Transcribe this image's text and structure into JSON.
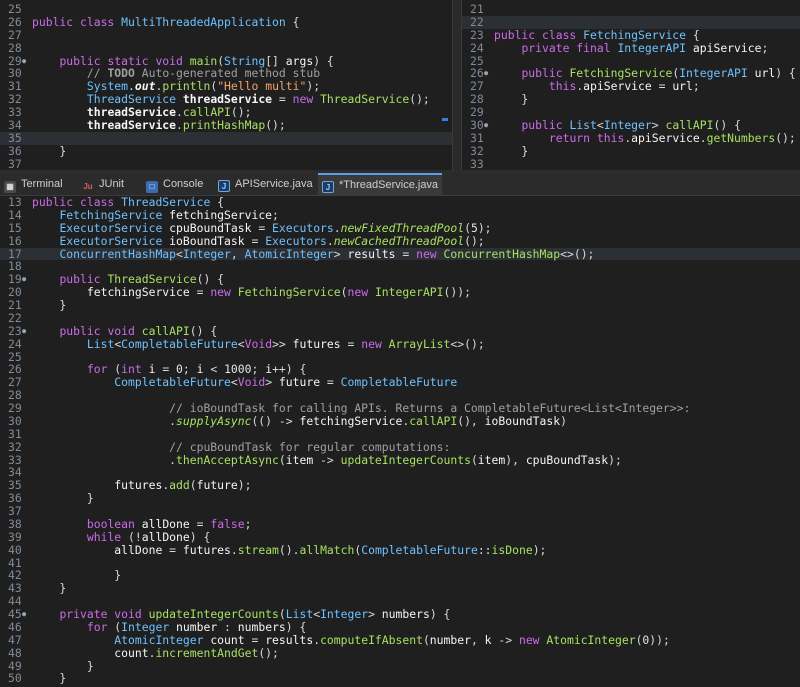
{
  "left_editor": {
    "lines": [
      {
        "n": "25",
        "html": ""
      },
      {
        "n": "26",
        "html": "<span class='k'>public class</span> <span class='t'>MultiThreadedApplication</span> {"
      },
      {
        "n": "27",
        "html": ""
      },
      {
        "n": "28",
        "html": ""
      },
      {
        "n": "29",
        "marker": true,
        "html": "    <span class='k'>public static void</span> <span class='f'>main</span>(<span class='t'>String</span>[] <span class='v'>args</span>) {"
      },
      {
        "n": "30",
        "html": "        <span class='c'>// <b>TODO</b> Auto-generated method stub</span>"
      },
      {
        "n": "31",
        "html": "        <span class='t'>System</span>.<span class='v b i'>out</span>.<span class='f'>println</span>(<span class='s'>\"Hello multi\"</span>);"
      },
      {
        "n": "32",
        "html": "        <span class='t'>ThreadService</span> <span class='v b'>threadService</span> = <span class='k'>new</span> <span class='f'>ThreadService</span>();"
      },
      {
        "n": "33",
        "html": "        <span class='v b'>threadService</span>.<span class='f'>callAPI</span>();"
      },
      {
        "n": "34",
        "html": "        <span class='v b'>threadService</span>.<span class='f'>printHashMap</span>();"
      },
      {
        "n": "35",
        "current": true,
        "html": ""
      },
      {
        "n": "36",
        "html": "    }"
      },
      {
        "n": "37",
        "html": ""
      }
    ]
  },
  "right_editor": {
    "lines": [
      {
        "n": "21",
        "html": ""
      },
      {
        "n": "22",
        "current": true,
        "html": ""
      },
      {
        "n": "23",
        "html": "<span class='k'>public class</span> <span class='t'>FetchingService</span> {"
      },
      {
        "n": "24",
        "html": "    <span class='k'>private final</span> <span class='t'>IntegerAPI</span> <span class='v'>apiService</span>;"
      },
      {
        "n": "25",
        "html": ""
      },
      {
        "n": "26",
        "marker": true,
        "html": "    <span class='k'>public</span> <span class='f'>FetchingService</span>(<span class='t'>IntegerAPI</span> <span class='v'>url</span>) {"
      },
      {
        "n": "27",
        "html": "        <span class='k'>this</span>.<span class='v'>apiService</span> = <span class='v'>url</span>;"
      },
      {
        "n": "28",
        "html": "    }"
      },
      {
        "n": "29",
        "html": ""
      },
      {
        "n": "30",
        "marker": true,
        "html": "    <span class='k'>public</span> <span class='t'>List</span>&lt;<span class='t'>Integer</span>&gt; <span class='f'>callAPI</span>() {"
      },
      {
        "n": "31",
        "html": "        <span class='k'>return this</span>.<span class='v'>apiService</span>.<span class='f'>getNumbers</span>();"
      },
      {
        "n": "32",
        "html": "    }"
      },
      {
        "n": "33",
        "html": ""
      }
    ]
  },
  "tabs": [
    {
      "label": "Terminal",
      "icon": "terminal-icon",
      "active": false
    },
    {
      "label": "JUnit",
      "icon": "junit-icon",
      "active": false
    },
    {
      "label": "Console",
      "icon": "console-icon",
      "active": false
    },
    {
      "label": "APIService.java",
      "icon": "java-file-icon",
      "active": false
    },
    {
      "label": "*ThreadService.java",
      "icon": "java-file-icon",
      "active": true
    }
  ],
  "main_editor": {
    "lines": [
      {
        "n": "13",
        "html": "<span class='k'>public class</span> <span class='t'>ThreadService</span> {"
      },
      {
        "n": "14",
        "html": "    <span class='t'>FetchingService</span> <span class='v'>fetchingService</span>;"
      },
      {
        "n": "15",
        "html": "    <span class='t'>ExecutorService</span> <span class='v'>cpuBoundTask</span> = <span class='t'>Executors</span>.<span class='f i'>newFixedThreadPool</span>(<span class='n'>5</span>);"
      },
      {
        "n": "16",
        "html": "    <span class='t'>ExecutorService</span> <span class='v'>ioBoundTask</span> = <span class='t'>Executors</span>.<span class='f i'>newCachedThreadPool</span>();"
      },
      {
        "n": "17",
        "current": true,
        "html": "    <span class='t'>ConcurrentHashMap</span>&lt;<span class='t'>Integer</span>, <span class='t'>AtomicInteger</span>&gt; <span class='v'>results</span> = <span class='k'>new</span> <span class='f'>ConcurrentHashMap</span>&lt;&gt;();"
      },
      {
        "n": "18",
        "html": ""
      },
      {
        "n": "19",
        "marker": true,
        "html": "    <span class='k'>public</span> <span class='f'>ThreadService</span>() {"
      },
      {
        "n": "20",
        "html": "        <span class='v'>fetchingService</span> = <span class='k'>new</span> <span class='f'>FetchingService</span>(<span class='k'>new</span> <span class='f'>IntegerAPI</span>());"
      },
      {
        "n": "21",
        "html": "    }"
      },
      {
        "n": "22",
        "html": ""
      },
      {
        "n": "23",
        "marker": true,
        "html": "    <span class='k'>public void</span> <span class='f'>callAPI</span>() {"
      },
      {
        "n": "24",
        "html": "        <span class='t'>List</span>&lt;<span class='t'>CompletableFuture</span>&lt;<span class='k'>Void</span>&gt;&gt; <span class='v'>futures</span> = <span class='k'>new</span> <span class='f'>ArrayList</span>&lt;&gt;();"
      },
      {
        "n": "25",
        "html": ""
      },
      {
        "n": "26",
        "html": "        <span class='k'>for</span> (<span class='k'>int</span> <span class='v'>i</span> = <span class='n'>0</span>; <span class='v'>i</span> &lt; <span class='n'>1000</span>; <span class='v'>i</span>++) {"
      },
      {
        "n": "27",
        "html": "            <span class='t'>CompletableFuture</span>&lt;<span class='k'>Void</span>&gt; <span class='v'>future</span> = <span class='t'>CompletableFuture</span>"
      },
      {
        "n": "28",
        "html": ""
      },
      {
        "n": "29",
        "html": "                    <span class='c'>// ioBoundTask for calling APIs. Returns a CompletableFuture&lt;List&lt;Integer&gt;&gt;:</span>"
      },
      {
        "n": "30",
        "html": "                    .<span class='f i'>supplyAsync</span>(() -&gt; <span class='v'>fetchingService</span>.<span class='f'>callAPI</span>(), <span class='v'>ioBoundTask</span>)"
      },
      {
        "n": "31",
        "html": ""
      },
      {
        "n": "32",
        "html": "                    <span class='c'>// cpuBoundTask for regular computations:</span>"
      },
      {
        "n": "33",
        "html": "                    .<span class='f'>thenAcceptAsync</span>(<span class='v'>item</span> -&gt; <span class='f'>updateIntegerCounts</span>(<span class='v'>item</span>), <span class='v'>cpuBoundTask</span>);"
      },
      {
        "n": "34",
        "html": ""
      },
      {
        "n": "35",
        "html": "            <span class='v'>futures</span>.<span class='f'>add</span>(<span class='v'>future</span>);"
      },
      {
        "n": "36",
        "html": "        }"
      },
      {
        "n": "37",
        "html": ""
      },
      {
        "n": "38",
        "html": "        <span class='k'>boolean</span> <span class='v'>allDone</span> = <span class='k'>false</span>;"
      },
      {
        "n": "39",
        "html": "        <span class='k'>while</span> (!<span class='v'>allDone</span>) {"
      },
      {
        "n": "40",
        "html": "            <span class='v'>allDone</span> = <span class='v'>futures</span>.<span class='f'>stream</span>().<span class='f'>allMatch</span>(<span class='t'>CompletableFuture</span>::<span class='f'>isDone</span>);"
      },
      {
        "n": "41",
        "html": ""
      },
      {
        "n": "42",
        "html": "            }"
      },
      {
        "n": "43",
        "html": "    }"
      },
      {
        "n": "44",
        "html": ""
      },
      {
        "n": "45",
        "marker": true,
        "html": "    <span class='k'>private void</span> <span class='f'>updateIntegerCounts</span>(<span class='t'>List</span>&lt;<span class='t'>Integer</span>&gt; <span class='v'>numbers</span>) {"
      },
      {
        "n": "46",
        "html": "        <span class='k'>for</span> (<span class='t'>Integer</span> <span class='v'>number</span> : <span class='v'>numbers</span>) {"
      },
      {
        "n": "47",
        "html": "            <span class='t'>AtomicInteger</span> <span class='v'>count</span> = <span class='v'>results</span>.<span class='f'>computeIfAbsent</span>(<span class='v'>number</span>, <span class='v'>k</span> -&gt; <span class='k'>new</span> <span class='f'>AtomicInteger</span>(<span class='n'>0</span>));"
      },
      {
        "n": "48",
        "html": "            <span class='v'>count</span>.<span class='f'>incrementAndGet</span>();"
      },
      {
        "n": "49",
        "html": "        }"
      },
      {
        "n": "50",
        "html": "    }"
      }
    ]
  }
}
